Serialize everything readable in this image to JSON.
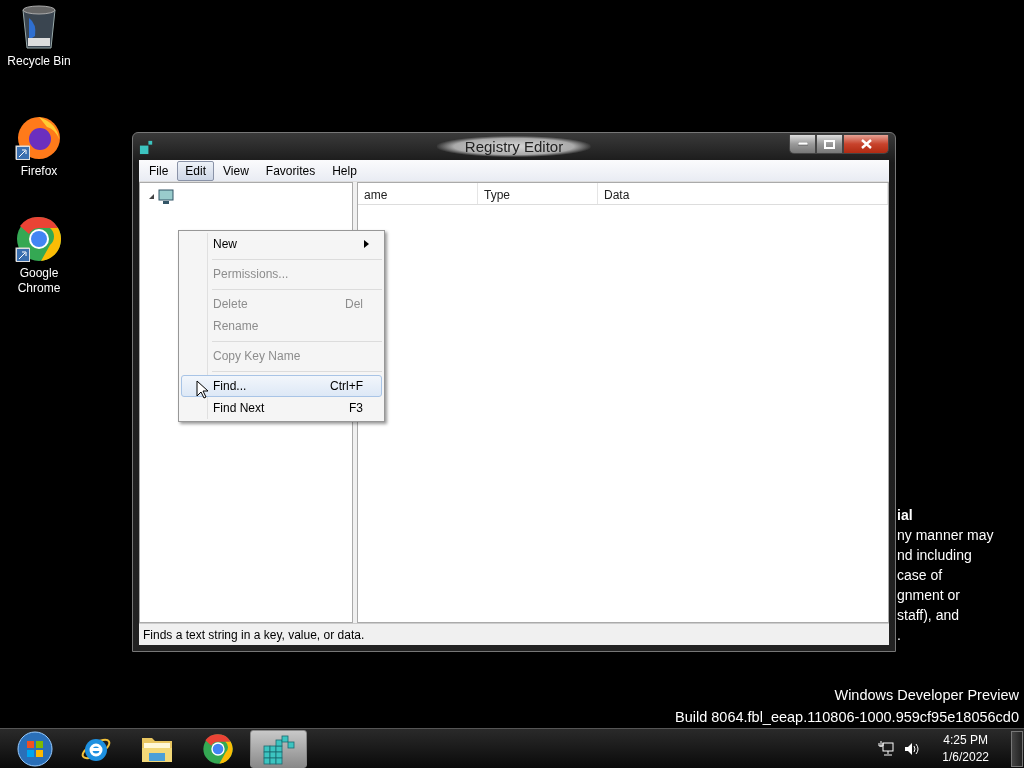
{
  "desktop_icons": [
    {
      "kind": "recycle",
      "label": "Recycle Bin",
      "shortcut": false
    },
    {
      "kind": "firefox",
      "label": "Firefox",
      "shortcut": true
    },
    {
      "kind": "chrome",
      "label": "Google Chrome",
      "shortcut": true
    }
  ],
  "background_text": {
    "heading": "ial",
    "lines": [
      "ny manner may",
      "nd including",
      "case of",
      "gnment or",
      "staff), and",
      "."
    ]
  },
  "window": {
    "title": "Registry Editor",
    "menu": [
      {
        "label": "File",
        "selected": false
      },
      {
        "label": "Edit",
        "selected": true
      },
      {
        "label": "View",
        "selected": false
      },
      {
        "label": "Favorites",
        "selected": false
      },
      {
        "label": "Help",
        "selected": false
      }
    ],
    "edit_menu": [
      {
        "kind": "item",
        "label": "New",
        "submenu": true,
        "disabled": false,
        "highlighted": false
      },
      {
        "kind": "separator"
      },
      {
        "kind": "item",
        "label": "Permissions...",
        "submenu": false,
        "disabled": true,
        "highlighted": false
      },
      {
        "kind": "separator"
      },
      {
        "kind": "item",
        "label": "Delete",
        "shortcut": "Del",
        "submenu": false,
        "disabled": true,
        "highlighted": false
      },
      {
        "kind": "item",
        "label": "Rename",
        "submenu": false,
        "disabled": true,
        "highlighted": false
      },
      {
        "kind": "separator"
      },
      {
        "kind": "item",
        "label": "Copy Key Name",
        "submenu": false,
        "disabled": true,
        "highlighted": false
      },
      {
        "kind": "separator"
      },
      {
        "kind": "item",
        "label": "Find...",
        "shortcut": "Ctrl+F",
        "submenu": false,
        "disabled": false,
        "highlighted": true
      },
      {
        "kind": "item",
        "label": "Find Next",
        "shortcut": "F3",
        "submenu": false,
        "disabled": false,
        "highlighted": false
      }
    ],
    "tree": [
      {
        "expanded": true
      }
    ],
    "columns": [
      "ame",
      "Type",
      "Data"
    ],
    "status_bar": "Finds a text string in a key, value, or data."
  },
  "build_info": [
    "Windows Developer Preview",
    "Build 8064.fbl_eeap.110806-1000.959cf95e18056cd0"
  ],
  "taskbar": {
    "buttons": [
      {
        "kind": "start",
        "selected": false
      },
      {
        "kind": "ie",
        "selected": false
      },
      {
        "kind": "explorer",
        "selected": false
      },
      {
        "kind": "chrome",
        "selected": false
      },
      {
        "kind": "regedit",
        "selected": true
      }
    ],
    "time": "4:25 PM",
    "date": "1/6/2022"
  }
}
